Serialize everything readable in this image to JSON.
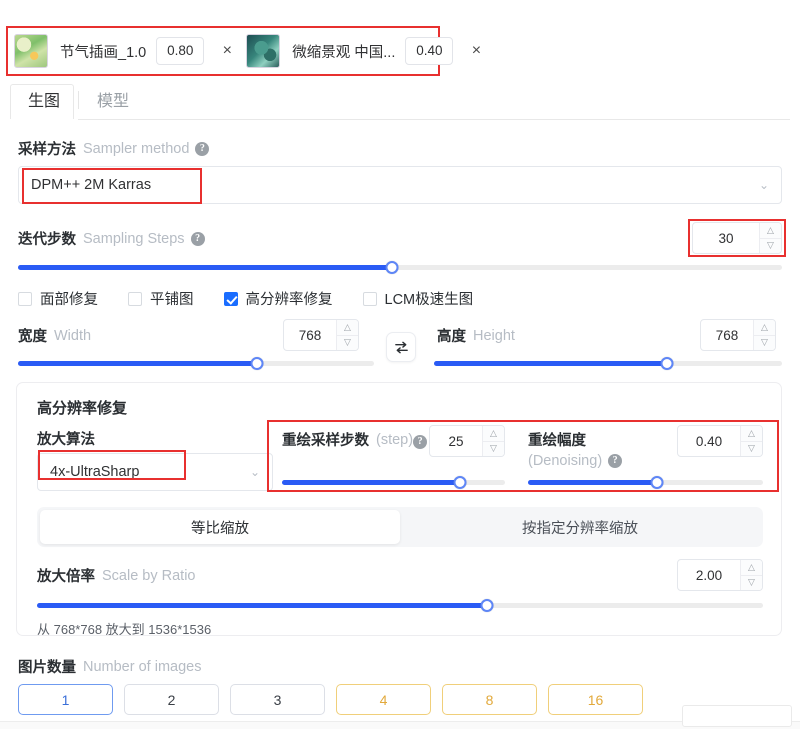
{
  "lora_bar": {
    "items": [
      {
        "thumb": "spring-illustration-thumb",
        "name": "节气插画_1.0",
        "weight": "0.80",
        "close": "×"
      },
      {
        "thumb": "miniature-landscape-thumb",
        "name": "微缩景观 中国...",
        "weight": "0.40",
        "close": "×"
      }
    ]
  },
  "tabs": [
    {
      "label": "生图",
      "active": true
    },
    {
      "label": "模型",
      "active": false
    }
  ],
  "sampler": {
    "label_cn": "采样方法",
    "label_en": "Sampler method",
    "help": "?",
    "value": "DPM++ 2M Karras",
    "chevron": "⌄"
  },
  "steps": {
    "label_cn": "迭代步数",
    "label_en": "Sampling Steps",
    "help": "?",
    "value": "30",
    "slider_percent": 49
  },
  "checkboxes": [
    {
      "label": "面部修复",
      "checked": false
    },
    {
      "label": "平铺图",
      "checked": false
    },
    {
      "label": "高分辨率修复",
      "checked": true
    },
    {
      "label": "LCM极速生图",
      "checked": false
    }
  ],
  "width": {
    "label_cn": "宽度",
    "label_en": "Width",
    "value": "768",
    "slider_percent": 67
  },
  "height": {
    "label_cn": "高度",
    "label_en": "Height",
    "value": "768",
    "slider_percent": 67
  },
  "swap": {
    "icon": "⇄"
  },
  "hires": {
    "title": "高分辨率修复",
    "upscaler": {
      "label_cn": "放大算法",
      "value": "4x-UltraSharp",
      "chevron": "⌄"
    },
    "hr_steps": {
      "label_cn": "重绘采样步数",
      "label_en": "(step)",
      "help": "?",
      "value": "25",
      "slider_percent": 80
    },
    "denoise": {
      "label_cn": "重绘幅度",
      "label_en": "(Denoising)",
      "help": "?",
      "value": "0.40",
      "slider_percent": 55
    },
    "mode_tabs": [
      {
        "label": "等比缩放",
        "active": true
      },
      {
        "label": "按指定分辨率缩放",
        "active": false
      }
    ],
    "ratio": {
      "label_cn": "放大倍率",
      "label_en": "Scale by Ratio",
      "value": "2.00",
      "slider_percent": 62
    },
    "footnote": "从 768*768 放大到 1536*1536"
  },
  "image_count": {
    "label_cn": "图片数量",
    "label_en": "Number of images",
    "options": [
      {
        "label": "1",
        "state": "selected"
      },
      {
        "label": "2",
        "state": "normal"
      },
      {
        "label": "3",
        "state": "normal"
      },
      {
        "label": "4",
        "state": "vip"
      },
      {
        "label": "8",
        "state": "vip"
      },
      {
        "label": "16",
        "state": "vip"
      }
    ]
  },
  "colors": {
    "accent_blue": "#2a5bf5",
    "annotation_red": "#e8302f",
    "vip_amber": "#e2a93b"
  }
}
